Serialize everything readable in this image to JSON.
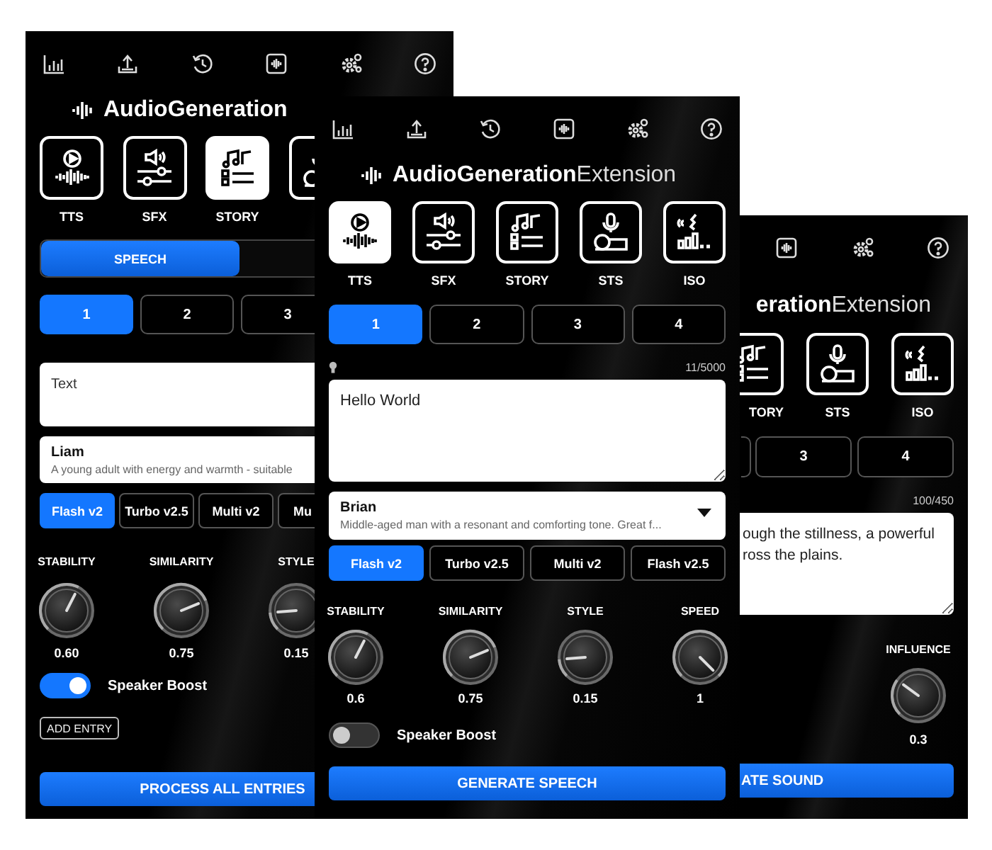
{
  "panels": [
    {
      "kind": "left",
      "logo": {
        "bold": "AudioGeneration"
      },
      "tiles": [
        {
          "kind": "tts",
          "label": "TTS",
          "selected": false
        },
        {
          "kind": "sfx",
          "label": "SFX",
          "selected": false
        },
        {
          "kind": "story",
          "label": "STORY",
          "selected": true
        },
        {
          "kind": "sts",
          "selected": false
        }
      ],
      "segments": [
        {
          "label": "SPEECH",
          "selected": true
        }
      ],
      "tabs": [
        {
          "label": "1",
          "selected": true
        },
        {
          "label": "2",
          "selected": false
        },
        {
          "label": "3",
          "selected": false
        }
      ],
      "text_field": {
        "placeholder": "Text"
      },
      "voice": {
        "name": "Liam",
        "description": "A young adult with energy and warmth - suitable"
      },
      "models": [
        {
          "label": "Flash v2",
          "selected": true
        },
        {
          "label": "Turbo v2.5",
          "selected": false
        },
        {
          "label": "Multi v2",
          "selected": false
        },
        {
          "label": "Mu",
          "selected": false
        }
      ],
      "knobs": [
        {
          "label": "STABILITY",
          "value": "0.60"
        },
        {
          "label": "SIMILARITY",
          "value": "0.75"
        },
        {
          "label": "STYLE",
          "value": "0.15"
        }
      ],
      "toggle": {
        "label": "Speaker Boost",
        "on": true
      },
      "add_button": "ADD ENTRY",
      "primary_button": "PROCESS ALL ENTRIES"
    },
    {
      "kind": "main",
      "logo": {
        "bold": "AudioGeneration",
        "light": "Extension"
      },
      "tiles": [
        {
          "kind": "tts",
          "label": "TTS",
          "selected": true
        },
        {
          "kind": "sfx",
          "label": "SFX",
          "selected": false
        },
        {
          "kind": "story",
          "label": "STORY",
          "selected": false
        },
        {
          "kind": "sts",
          "label": "STS",
          "selected": false
        },
        {
          "kind": "iso",
          "label": "ISO",
          "selected": false
        }
      ],
      "tabs": [
        {
          "label": "1",
          "selected": true
        },
        {
          "label": "2",
          "selected": false
        },
        {
          "label": "3",
          "selected": false
        },
        {
          "label": "4",
          "selected": false
        }
      ],
      "hint_icon": true,
      "counter": "11/5000",
      "text_area": {
        "value": "Hello World"
      },
      "voice": {
        "name": "Brian",
        "description": "Middle-aged man with a resonant and comforting tone. Great f..."
      },
      "models": [
        {
          "label": "Flash v2",
          "selected": true
        },
        {
          "label": "Turbo v2.5",
          "selected": false
        },
        {
          "label": "Multi v2",
          "selected": false
        },
        {
          "label": "Flash v2.5",
          "selected": false
        }
      ],
      "knobs": [
        {
          "label": "STABILITY",
          "value": "0.6"
        },
        {
          "label": "SIMILARITY",
          "value": "0.75"
        },
        {
          "label": "STYLE",
          "value": "0.15"
        },
        {
          "label": "SPEED",
          "value": "1"
        }
      ],
      "toggle": {
        "label": "Speaker Boost",
        "on": false
      },
      "primary_button": "GENERATE SPEECH"
    },
    {
      "kind": "right",
      "logo": {
        "bold": "eration",
        "light": "Extension"
      },
      "tiles": [
        {
          "kind": "story",
          "label": "TORY",
          "selected": false
        },
        {
          "kind": "sts",
          "label": "STS",
          "selected": false
        },
        {
          "kind": "iso",
          "label": "ISO",
          "selected": false
        }
      ],
      "tabs": [
        {
          "label": "3",
          "selected": false
        },
        {
          "label": "4",
          "selected": false
        }
      ],
      "counter": "100/450",
      "text_area": {
        "value": "ough the stillness, a powerful\nross the plains."
      },
      "knobs": [
        {
          "label": "INFLUENCE",
          "value": "0.3"
        }
      ],
      "primary_button": "ATE SOUND"
    }
  ]
}
